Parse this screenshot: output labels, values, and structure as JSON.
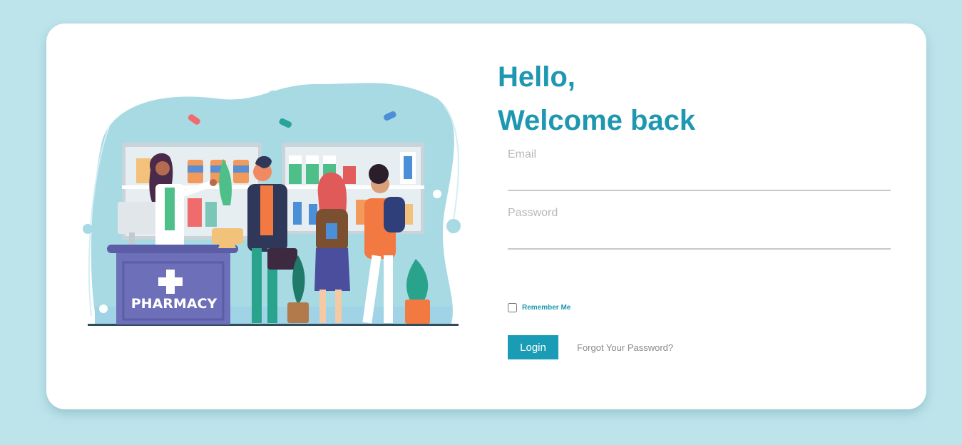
{
  "heading": {
    "line1": "Hello,",
    "line2": "Welcome back"
  },
  "email": {
    "label": "Email",
    "value": ""
  },
  "password": {
    "label": "Password",
    "value": ""
  },
  "remember": {
    "label": "Remember Me",
    "checked": false
  },
  "login_label": "Login",
  "forgot_label": "Forgot Your Password?",
  "illustration": {
    "counter_text": "PHARMACY",
    "description_icon": "pharmacy-illustration"
  },
  "colors": {
    "background": "#bde4eb",
    "accent": "#1e97b0",
    "button": "#1b9cb6",
    "counter": "#5b5ea6"
  }
}
